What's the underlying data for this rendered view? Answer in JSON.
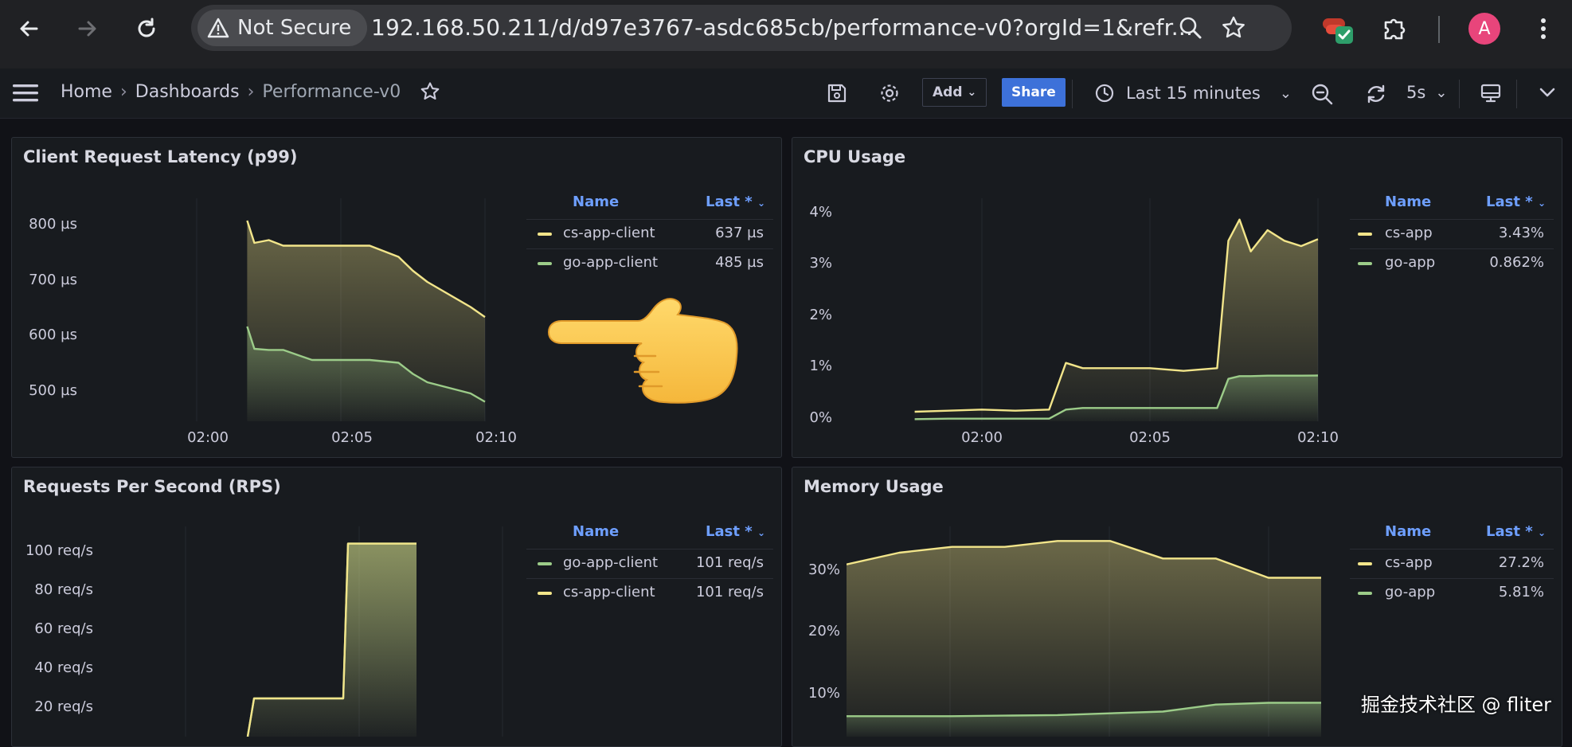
{
  "browser": {
    "security_label": "Not Secure",
    "url": "192.168.50.211/d/d97e3767-asdc685cb/performance-v0?orgId=1&refr...",
    "avatar_letter": "A"
  },
  "topbar": {
    "breadcrumb": [
      "Home",
      "Dashboards",
      "Performance-v0"
    ],
    "add_label": "Add",
    "share_label": "Share",
    "time_range": "Last 15 minutes",
    "refresh_interval": "5s"
  },
  "colors": {
    "yellow": "#f2e58a",
    "green": "#9ccc89",
    "accent": "#3d71d9"
  },
  "panels": [
    {
      "title": "Client Request Latency (p99)",
      "legend": {
        "name_header": "Name",
        "last_header": "Last *",
        "rows": [
          {
            "name": "cs-app-client",
            "value": "637 µs",
            "color": "yellow"
          },
          {
            "name": "go-app-client",
            "value": "485 µs",
            "color": "green"
          }
        ]
      },
      "yticks": [
        "800 µs",
        "700 µs",
        "600 µs",
        "500 µs"
      ],
      "xticks": [
        "02:00",
        "02:05",
        "02:10"
      ]
    },
    {
      "title": "CPU Usage",
      "legend": {
        "name_header": "Name",
        "last_header": "Last *",
        "rows": [
          {
            "name": "cs-app",
            "value": "3.43%",
            "color": "yellow"
          },
          {
            "name": "go-app",
            "value": "0.862%",
            "color": "green"
          }
        ]
      },
      "yticks": [
        "4%",
        "3%",
        "2%",
        "1%",
        "0%"
      ],
      "xticks": [
        "02:00",
        "02:05",
        "02:10"
      ]
    },
    {
      "title": "Requests Per Second (RPS)",
      "legend": {
        "name_header": "Name",
        "last_header": "Last *",
        "rows": [
          {
            "name": "go-app-client",
            "value": "101 req/s",
            "color": "green"
          },
          {
            "name": "cs-app-client",
            "value": "101 req/s",
            "color": "yellow"
          }
        ]
      },
      "yticks": [
        "100 req/s",
        "80 req/s",
        "60 req/s",
        "40 req/s",
        "20 req/s"
      ],
      "xticks": []
    },
    {
      "title": "Memory Usage",
      "legend": {
        "name_header": "Name",
        "last_header": "Last *",
        "rows": [
          {
            "name": "cs-app",
            "value": "27.2%",
            "color": "yellow"
          },
          {
            "name": "go-app",
            "value": "5.81%",
            "color": "green"
          }
        ]
      },
      "yticks": [
        "30%",
        "20%",
        "10%"
      ],
      "xticks": []
    }
  ],
  "chart_data": [
    {
      "type": "area",
      "xlim": [
        "01:58",
        "02:10"
      ],
      "x": [
        "02:01:45",
        "02:02:00",
        "02:02:30",
        "02:03:00",
        "02:04:00",
        "02:06:00",
        "02:07:00",
        "02:07:30",
        "02:08:00",
        "02:09:30",
        "02:10:00"
      ],
      "ylim": [
        450,
        850
      ],
      "series": [
        {
          "name": "cs-app-client",
          "values": [
            810,
            770,
            775,
            765,
            765,
            765,
            745,
            720,
            700,
            655,
            637
          ]
        },
        {
          "name": "go-app-client",
          "values": [
            620,
            580,
            578,
            578,
            560,
            560,
            555,
            535,
            520,
            500,
            485
          ]
        }
      ]
    },
    {
      "type": "area",
      "xlim": [
        "01:58",
        "02:10"
      ],
      "x": [
        "01:58",
        "01:59",
        "02:00",
        "02:01",
        "02:02",
        "02:02:30",
        "02:03",
        "02:04",
        "02:05",
        "02:06",
        "02:07",
        "02:07:20",
        "02:07:40",
        "02:08",
        "02:08:30",
        "02:09",
        "02:09:30",
        "02:10"
      ],
      "ylim": [
        0,
        4.2
      ],
      "series": [
        {
          "name": "cs-app",
          "values": [
            0.18,
            0.2,
            0.22,
            0.2,
            0.22,
            1.1,
            1.0,
            1.0,
            1.0,
            0.95,
            1.0,
            3.4,
            3.8,
            3.2,
            3.6,
            3.4,
            3.3,
            3.43
          ]
        },
        {
          "name": "go-app",
          "values": [
            0.04,
            0.05,
            0.05,
            0.05,
            0.05,
            0.22,
            0.25,
            0.25,
            0.25,
            0.25,
            0.25,
            0.8,
            0.85,
            0.85,
            0.86,
            0.86,
            0.86,
            0.862
          ]
        }
      ]
    },
    {
      "type": "area",
      "x": [
        "t0",
        "t1",
        "t2",
        "t3",
        "t4",
        "t5",
        "t6",
        "t7"
      ],
      "ylim": [
        0,
        110
      ],
      "series": [
        {
          "name": "go-app-client",
          "values": [
            0,
            20,
            20,
            20,
            20,
            101,
            101,
            101
          ]
        },
        {
          "name": "cs-app-client",
          "values": [
            0,
            20,
            20,
            20,
            20,
            101,
            101,
            101
          ]
        }
      ]
    },
    {
      "type": "area",
      "x": [
        "t0",
        "t1",
        "t2",
        "t3",
        "t4",
        "t5",
        "t6",
        "t7",
        "t8",
        "t9"
      ],
      "ylim": [
        0,
        36
      ],
      "series": [
        {
          "name": "cs-app",
          "values": [
            29.5,
            31.5,
            32.5,
            32.5,
            33.5,
            33.5,
            30.5,
            30.5,
            27.2,
            27.2
          ]
        },
        {
          "name": "go-app",
          "values": [
            3.5,
            3.5,
            3.5,
            3.6,
            3.7,
            4.0,
            4.3,
            5.5,
            5.8,
            5.81
          ]
        }
      ]
    }
  ],
  "watermark": "掘金技术社区 @ fliter"
}
